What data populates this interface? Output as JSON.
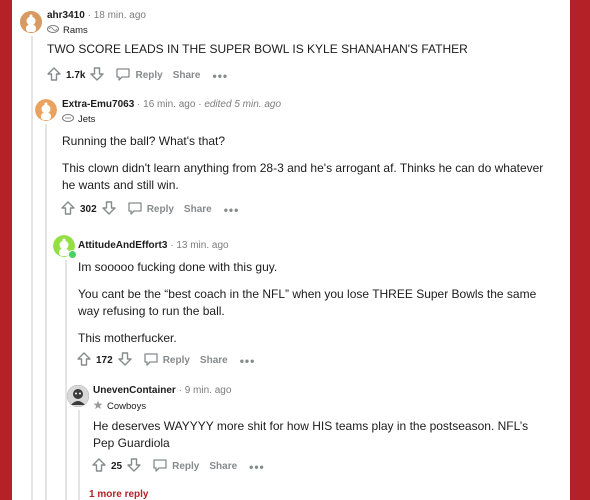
{
  "comments": [
    {
      "username": "ahr3410",
      "time": "18 min. ago",
      "edited": "",
      "flair": "Rams",
      "body": [
        "TWO SCORE LEADS IN THE SUPER BOWL IS KYLE SHANAHAN'S FATHER"
      ],
      "score": "1.7k",
      "reply_label": "Reply",
      "share_label": "Share"
    },
    {
      "username": "Extra-Emu7063",
      "time": "16 min. ago",
      "edited": "edited 5 min. ago",
      "flair": "Jets",
      "body": [
        "Running the ball? What's that?",
        "This clown didn't learn anything from 28-3 and he's arrogant af. Thinks he can do whatever he wants and still win."
      ],
      "score": "302",
      "reply_label": "Reply",
      "share_label": "Share"
    },
    {
      "username": "AttitudeAndEffort3",
      "time": "13 min. ago",
      "edited": "",
      "flair": "",
      "body": [
        "Im sooooo fucking done with this guy.",
        "You cant be the “best coach in the NFL” when you lose THREE Super Bowls the same way refusing to run the ball.",
        "This motherfucker."
      ],
      "score": "172",
      "reply_label": "Reply",
      "share_label": "Share"
    },
    {
      "username": "UnevenContainer",
      "time": "9 min. ago",
      "edited": "",
      "flair": "Cowboys",
      "body": [
        "He deserves WAYYYY more shit for how HIS teams play in the postseason. NFL’s Pep Guardiola"
      ],
      "score": "25",
      "reply_label": "Reply",
      "share_label": "Share"
    }
  ],
  "more_replies": "1 more reply",
  "colors": {
    "frame": "#b42126",
    "online": "#46d160"
  }
}
